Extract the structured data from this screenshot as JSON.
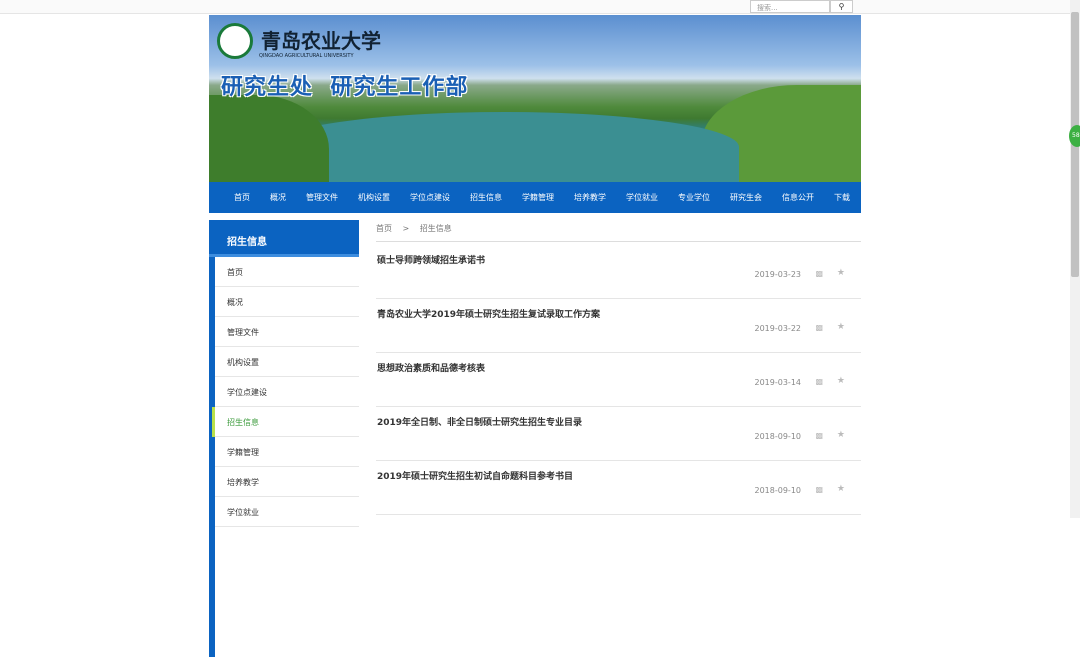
{
  "search": {
    "placeholder": "搜索...",
    "button_icon": "search-icon"
  },
  "banner": {
    "logo_text": "青岛农业大学",
    "logo_sub": "QINGDAO AGRICULTURAL UNIVERSITY",
    "title": "研究生处  研究生工作部"
  },
  "nav": [
    "首页",
    "概况",
    "管理文件",
    "机构设置",
    "学位点建设",
    "招生信息",
    "学籍管理",
    "培养教学",
    "学位就业",
    "专业学位",
    "研究生会",
    "信息公开",
    "下载"
  ],
  "sidebar": {
    "title": "招生信息",
    "items": [
      "首页",
      "概况",
      "管理文件",
      "机构设置",
      "学位点建设",
      "招生信息",
      "学籍管理",
      "培养教学",
      "学位就业"
    ],
    "active": "招生信息"
  },
  "breadcrumb": {
    "home": "首页",
    "sep": ">",
    "current": "招生信息"
  },
  "articles": [
    {
      "title": "硕士导师跨领域招生承诺书",
      "date": "2019-03-23"
    },
    {
      "title": "青岛农业大学2019年硕士研究生招生复试录取工作方案",
      "date": "2019-03-22"
    },
    {
      "title": "思想政治素质和品德考核表",
      "date": "2019-03-14"
    },
    {
      "title": "2019年全日制、非全日制硕士研究生招生专业目录",
      "date": "2018-09-10"
    },
    {
      "title": "2019年硕士研究生招生初试自命题科目参考书目",
      "date": "2018-09-10"
    }
  ],
  "float_badge": "58"
}
